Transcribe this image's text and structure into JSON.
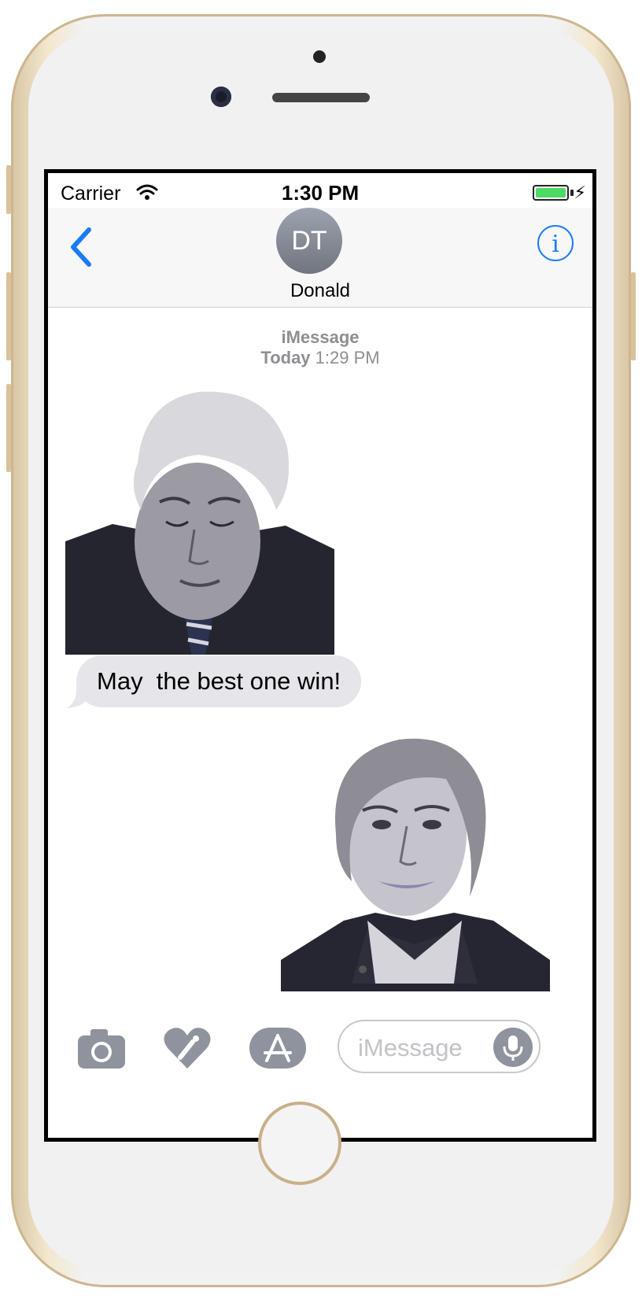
{
  "status_bar": {
    "carrier": "Carrier",
    "time": "1:30 PM",
    "battery_color": "#4cd964"
  },
  "navbar": {
    "back_icon": "chevron-left-icon",
    "avatar_initials": "DT",
    "contact_name": "Donald",
    "info_glyph": "i",
    "accent_color": "#1a7cf5"
  },
  "conversation": {
    "service": "iMessage",
    "day": "Today",
    "timestamp": "1:29 PM",
    "messages": [
      {
        "type": "sticker",
        "from": "them",
        "subject": "man-in-suit-sticker"
      },
      {
        "type": "text",
        "from": "them",
        "text": "May  the best one win!"
      },
      {
        "type": "sticker",
        "from": "me",
        "subject": "woman-portrait-sticker"
      }
    ]
  },
  "compose": {
    "icons": [
      "camera-icon",
      "digital-touch-heart-icon",
      "app-store-icon",
      "microphone-icon"
    ],
    "placeholder": "iMessage"
  }
}
